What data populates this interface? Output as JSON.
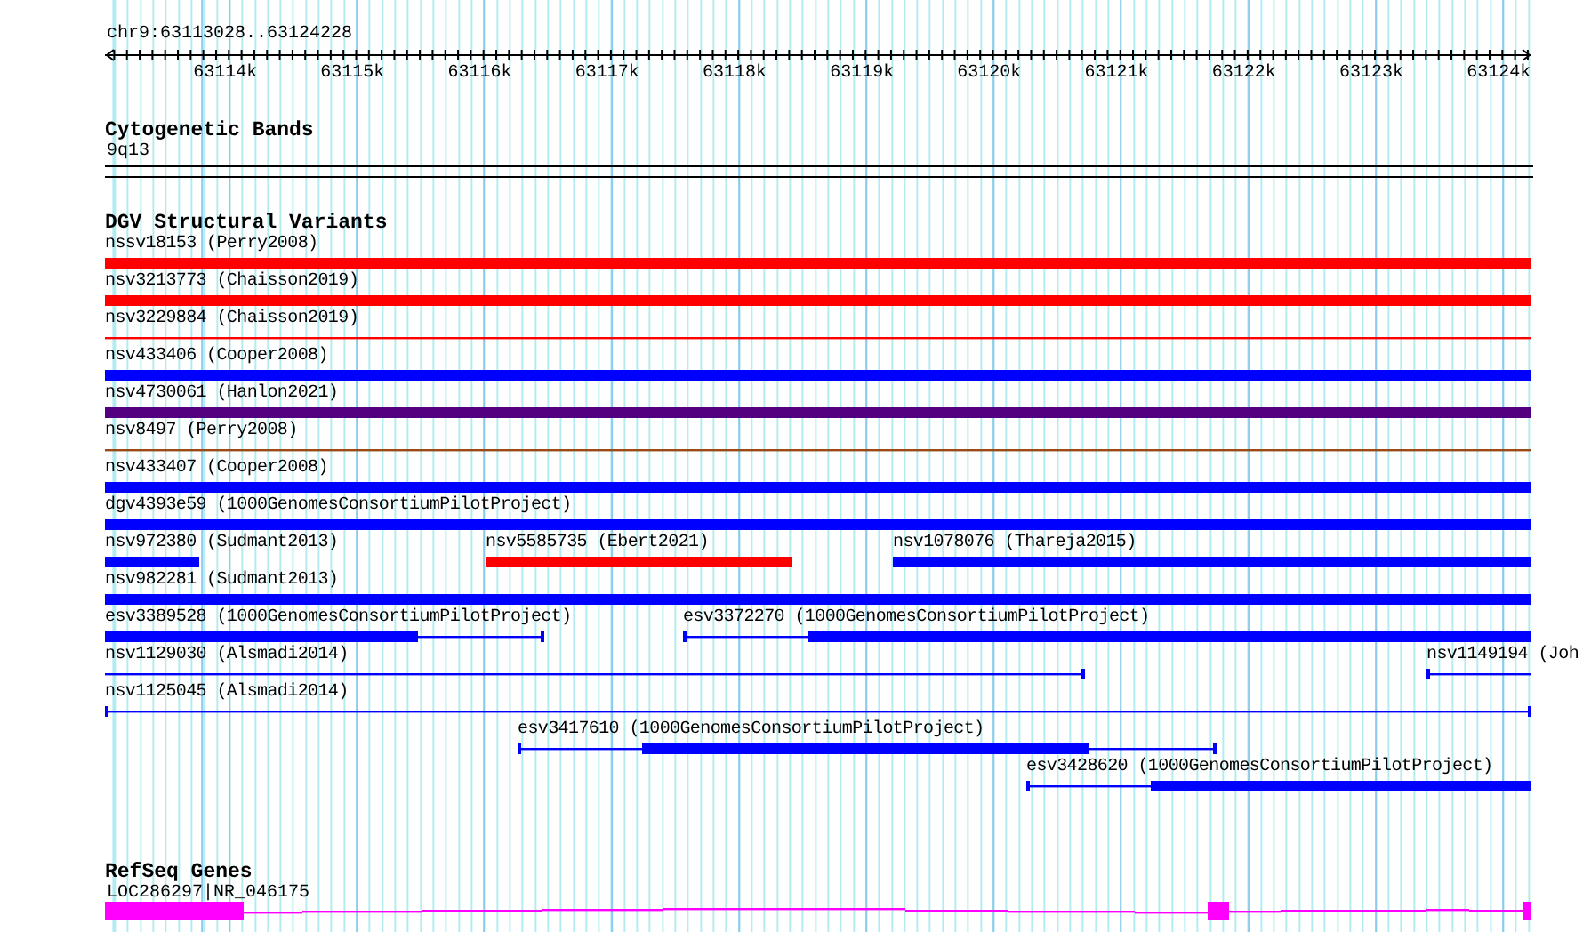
{
  "ruler": {
    "location": "chr9:63113028..63124228",
    "ticks": [
      "63114k",
      "63115k",
      "63116k",
      "63117k",
      "63118k",
      "63119k",
      "63120k",
      "63121k",
      "63122k",
      "63123k",
      "63124k"
    ]
  },
  "cytogenetic_bands": {
    "title": "Cytogenetic Bands",
    "band": "9q13"
  },
  "dgv_track": {
    "title": "DGV Structural Variants",
    "rows": [
      {
        "features": [
          {
            "label": "nssv18153 (Perry2008)",
            "color": "#ff0000",
            "kind": "thick"
          }
        ]
      },
      {
        "features": [
          {
            "label": "nsv3213773 (Chaisson2019)",
            "color": "#ff0000",
            "kind": "thick"
          }
        ]
      },
      {
        "features": [
          {
            "label": "nsv3229884 (Chaisson2019)",
            "color": "#ff0000",
            "kind": "thin"
          }
        ]
      },
      {
        "features": [
          {
            "label": "nsv433406 (Cooper2008)",
            "color": "#0000ff",
            "kind": "thick"
          }
        ]
      },
      {
        "features": [
          {
            "label": "nsv4730061 (Hanlon2021)",
            "color": "#520080",
            "kind": "thick"
          }
        ]
      },
      {
        "features": [
          {
            "label": "nsv8497 (Perry2008)",
            "color": "#9a4a14",
            "kind": "thin"
          }
        ]
      },
      {
        "features": [
          {
            "label": "nsv433407 (Cooper2008)",
            "color": "#0000ff",
            "kind": "thick"
          }
        ]
      },
      {
        "features": [
          {
            "label": "dgv4393e59 (1000GenomesConsortiumPilotProject)",
            "color": "#0000ff",
            "kind": "thick"
          }
        ]
      },
      {
        "features": [
          {
            "label": "nsv972380 (Sudmant2013)",
            "color": "#0000ff",
            "kind": "thick"
          },
          {
            "label": "nsv5585735 (Ebert2021)",
            "color": "#ff0000",
            "kind": "thick"
          },
          {
            "label": "nsv1078076 (Thareja2015)",
            "color": "#0000ff",
            "kind": "thick"
          }
        ]
      },
      {
        "features": [
          {
            "label": "nsv982281 (Sudmant2013)",
            "color": "#0000ff",
            "kind": "thick"
          }
        ]
      },
      {
        "features": [
          {
            "label": "esv3389528 (1000GenomesConsortiumPilotProject)",
            "color": "#0000ff",
            "kind": "mixed"
          },
          {
            "label": "esv3372270 (1000GenomesConsortiumPilotProject)",
            "color": "#0000ff",
            "kind": "mixed"
          }
        ]
      },
      {
        "features": [
          {
            "label": "nsv1129030 (Alsmadi2014)",
            "color": "#0000ff",
            "kind": "thin"
          },
          {
            "label": "nsv1149194 (Joh",
            "color": "#0000ff",
            "kind": "thin"
          }
        ]
      },
      {
        "features": [
          {
            "label": "nsv1125045 (Alsmadi2014)",
            "color": "#0000ff",
            "kind": "thin"
          }
        ]
      },
      {
        "features": [
          {
            "label": "esv3417610 (1000GenomesConsortiumPilotProject)",
            "color": "#0000ff",
            "kind": "mixed"
          }
        ]
      },
      {
        "features": [
          {
            "label": "esv3428620 (1000GenomesConsortiumPilotProject)",
            "color": "#0000ff",
            "kind": "mixed"
          }
        ]
      }
    ]
  },
  "refseq_track": {
    "title": "RefSeq Genes",
    "genes": [
      {
        "label": "LOC286297|NR_046175",
        "color": "#ff00ff"
      }
    ]
  }
}
